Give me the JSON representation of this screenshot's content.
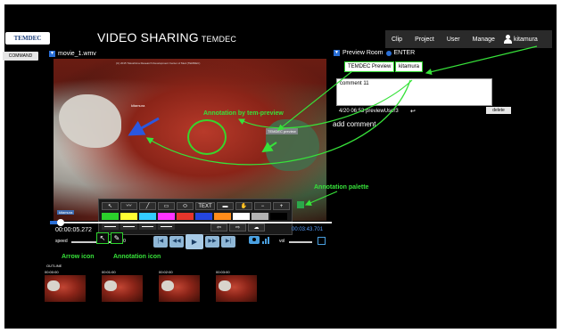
{
  "header": {
    "logo_text": "TEMDEC",
    "title": "VIDEO SHARING",
    "title_brand": "TEMDEC",
    "nav": [
      "Clip",
      "Project",
      "User",
      "Manage"
    ],
    "user_name": "kitamura"
  },
  "sidebar": {
    "command_label": "COMMAND"
  },
  "video": {
    "file_name": "movie_1.wmv",
    "caption": "(C) 2015 Tokushima Research Development Center of Med (TEMDEC)",
    "annotation_name_1": "kitamura",
    "annotation_name_2": "TEMDEC preview",
    "corner_tag": "kitamura"
  },
  "palette": {
    "tools": [
      "↖",
      "〰",
      "╱",
      "▭",
      "⬭",
      "TEXT",
      "▬",
      "✋",
      "−",
      "+"
    ],
    "colors": [
      "#2bd12b",
      "#ffff33",
      "#33ccff",
      "#ff33ff",
      "#e6352b",
      "#2446e0",
      "#ff8c1a",
      "#ffffff",
      "#b3b3b3",
      "#000000"
    ],
    "row3": [
      "⇦",
      "⇨",
      "☁"
    ]
  },
  "player": {
    "current_time": "00:00:05.272",
    "total_time": "00:03:43.701",
    "speed_label": "speed",
    "speed_value": "1.0",
    "volume_label": "vol",
    "buttons": [
      "|◀",
      "◀◀",
      "▶",
      "▶▶",
      "▶|"
    ],
    "progress_fraction": 0.03
  },
  "outline": {
    "label": "OUTLINE",
    "thumbs": [
      "00:00:00",
      "00:01:00",
      "00:02:00",
      "00:03:00"
    ]
  },
  "preview": {
    "room_label": "Preview Room",
    "enter_label": "ENTER",
    "tabs": [
      "TEMDEC Preview",
      "kitamura"
    ],
    "comment_text": "comment 11",
    "comment_meta": "4/20 06:53 previewUser3",
    "delete_label": "delete",
    "add_comment_label": "add comment"
  },
  "callouts": {
    "annotation_by_preview": "Annotation by tem-preview",
    "annotation_palette": "Annotation palette",
    "arrow_icon": "Arrow icon",
    "annotation_icon": "Annotation icon"
  },
  "colors": {
    "accent_green": "#37e23a",
    "accent_blue": "#2a6fd6",
    "background": "#000000"
  }
}
